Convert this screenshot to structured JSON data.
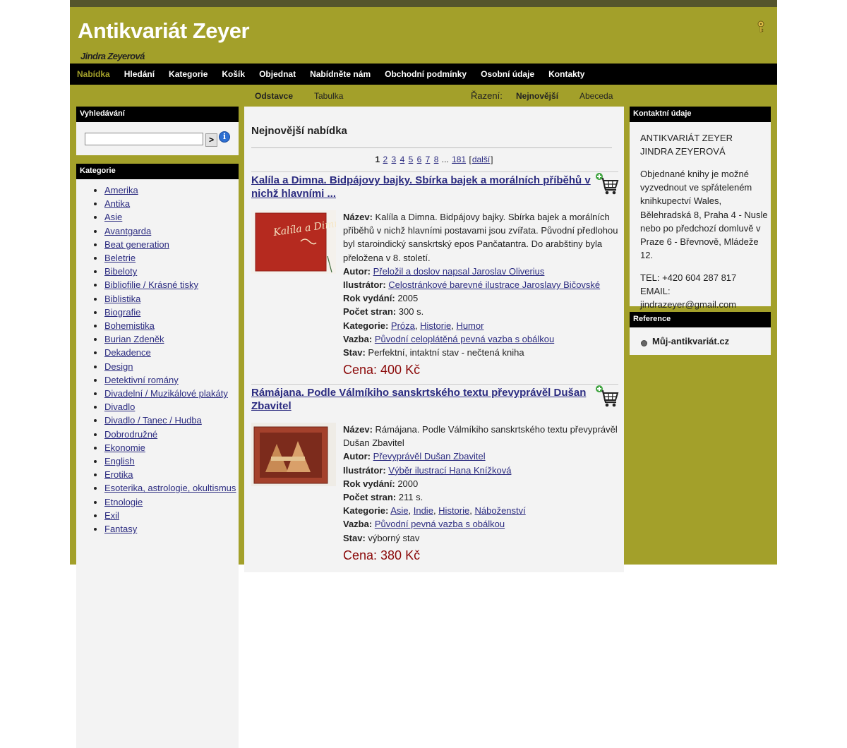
{
  "site": {
    "title": "Antikvariát Zeyer",
    "subtitle": "Jindra Zeyerová"
  },
  "nav": [
    "Nabídka",
    "Hledání",
    "Kategorie",
    "Košík",
    "Objednat",
    "Nabídněte nám",
    "Obchodní podmínky",
    "Osobní údaje",
    "Kontakty"
  ],
  "view": {
    "odstavce": "Odstavce",
    "tabulka": "Tabulka",
    "razeni": "Řazení:",
    "nejnovejsi": "Nejnovější",
    "abeceda": "Abeceda"
  },
  "search": {
    "heading": "Vyhledávání",
    "go": ">",
    "info": "i",
    "value": ""
  },
  "categories": {
    "heading": "Kategorie",
    "items": [
      "Amerika",
      "Antika",
      "Asie",
      "Avantgarda",
      "Beat generation",
      "Beletrie",
      "Bibeloty",
      "Bibliofilie / Krásné tisky",
      "Biblistika",
      "Biografie",
      "Bohemistika",
      "Burian Zdeněk",
      "Dekadence",
      "Design",
      "Detektivní romány",
      "Divadelní / Muzikálové plakáty",
      "Divadlo",
      "Divadlo / Tanec / Hudba",
      "Dobrodružné",
      "Ekonomie",
      "English",
      "Erotika",
      "Esoterika, astrologie, okultismus",
      "Etnologie",
      "Exil",
      "Fantasy"
    ]
  },
  "main": {
    "title": "Nejnovější nabídka",
    "pager": {
      "current": "1",
      "pages": [
        "2",
        "3",
        "4",
        "5",
        "6",
        "7",
        "8"
      ],
      "ellipsis": "...",
      "last": "181",
      "next": "další"
    },
    "labels": {
      "nazev": "Název:",
      "autor": "Autor:",
      "ilustrator": "Ilustrátor:",
      "rok": "Rok vydání:",
      "strany": "Počet stran:",
      "kategorie": "Kategorie:",
      "vazba": "Vazba:",
      "stav": "Stav:"
    },
    "books": [
      {
        "title": "Kalíla a Dimna. Bidpájovy bajky. Sbírka bajek a morálních příběhů v nichž hlavními ...",
        "name": "Kalíla a Dimna. Bidpájovy bajky. Sbírka bajek a morálních příběhů v nichž hlavními postavami jsou zvířata. Původní předlohou byl staroindický sanskrtský epos Pančatantra. Do arabštiny byla přeložena v 8. století.",
        "author": "Přeložil a doslov napsal Jaroslav Oliverius",
        "illustrator": "Celostránkové barevné ilustrace Jaroslavy Bičovské",
        "year": "2005",
        "pages": "300 s.",
        "categories": [
          "Próza",
          "Historie",
          "Humor"
        ],
        "binding": "Původní celoplátěná pevná vazba s obálkou",
        "condition": "Perfektní, intaktní stav - nečtená kniha",
        "price": "Cena: 400 Kč",
        "cover_text": "Kalíla a Dimna"
      },
      {
        "title": "Rámájana. Podle Válmíkiho sanskrtského textu převyprávěl Dušan Zbavitel",
        "name": "Rámájana. Podle Válmíkiho sanskrtského textu převyprávěl Dušan Zbavitel",
        "author": "Převyprávěl Dušan Zbavitel",
        "illustrator": "Výběr ilustrací Hana Knížková",
        "year": "2000",
        "pages": "211 s.",
        "categories": [
          "Asie",
          "Indie",
          "Historie",
          "Náboženství"
        ],
        "binding": "Původní pevná vazba s obálkou",
        "condition": "výborný stav",
        "price": "Cena: 380 Kč"
      }
    ]
  },
  "contact": {
    "heading": "Kontaktní údaje",
    "name1": "ANTIKVARIÁT ZEYER",
    "name2": "JINDRA ZEYEROVÁ",
    "note": "Objednané knihy je možné vyzvednout ve spřáteleném knihkupectví Wales, Bělehradská 8, Praha 4 - Nusle nebo po předchozí domluvě v Praze 6 - Břevnově, Mládeže 12.",
    "tel": "TEL: +420 604 287 817",
    "email": "EMAIL: jindrazeyer@gmail.com"
  },
  "reference": {
    "heading": "Reference",
    "link": "Můj-antikvariát.cz"
  },
  "colors": {
    "olive": "#a3a02a",
    "nav_bg": "#000000",
    "panel_bg": "#f3f3f3",
    "link": "#2b2b80",
    "price": "#8b0a0a"
  }
}
